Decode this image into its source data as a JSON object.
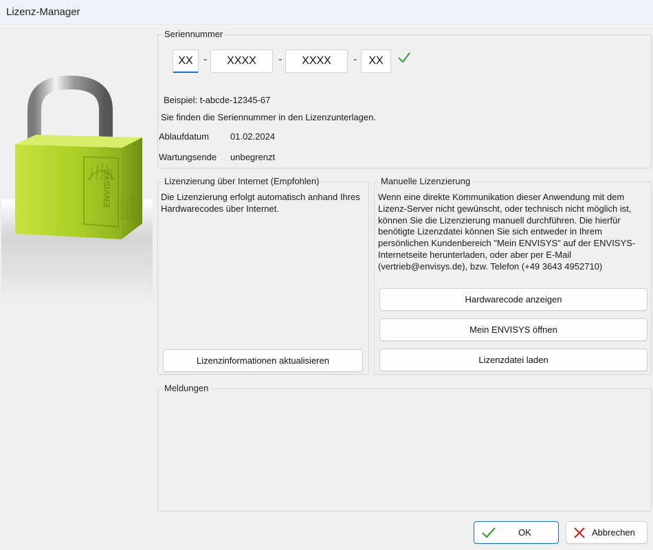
{
  "window": {
    "title": "Lizenz-Manager"
  },
  "serial": {
    "group_label": "Seriennummer",
    "part1": "XX",
    "part2": "XXXX",
    "part3": "XXXX",
    "part4": "XX",
    "separator": "-",
    "example": "Beispiel: t-abcde-12345-67",
    "hint": "Sie finden die Seriennummer in den Lizenzunterlagen.",
    "expiry_label": "Ablaufdatum",
    "expiry_value": "01.02.2024",
    "maintenance_label": "Wartungsende",
    "maintenance_value": "unbegrenzt"
  },
  "online": {
    "group_label": "Lizenzierung über Internet (Empfohlen)",
    "description": "Die Lizenzierung erfolgt automatisch anhand Ihres Hardwarecodes über Internet.",
    "update_button": "Lizenzinformationen aktualisieren"
  },
  "manual": {
    "group_label": "Manuelle Lizenzierung",
    "description": "Wenn eine direkte Kommunikation dieser Anwendung mit dem Lizenz-Server nicht gewünscht, oder technisch nicht möglich ist, können Sie die Lizenzierung manuell durchführen. Die hierfür benötigte Lizenzdatei können Sie sich entweder in Ihrem persönlichen Kundenbereich \"Mein ENVISYS\" auf der ENVISYS-Internetseite herunterladen, oder aber per E-Mail (vertrieb@envisys.de), bzw. Telefon (+49 3643 4952710)",
    "hardwarecode_button": "Hardwarecode anzeigen",
    "mein_envisys_button": "Mein ENVISYS öffnen",
    "load_file_button": "Lizenzdatei laden"
  },
  "messages": {
    "group_label": "Meldungen"
  },
  "footer": {
    "ok_label": "OK",
    "cancel_label": "Abbrechen"
  },
  "logo": {
    "brand": "ENVISYS",
    "line1": "BERATUNG",
    "line2": "ENERGIE",
    "line3": "SOFTWARE"
  },
  "colors": {
    "lock_green": "#a8cf2a",
    "check_green": "#3a9a3a",
    "cancel_red": "#c42b1c",
    "focus_blue": "#1a6fc9"
  }
}
